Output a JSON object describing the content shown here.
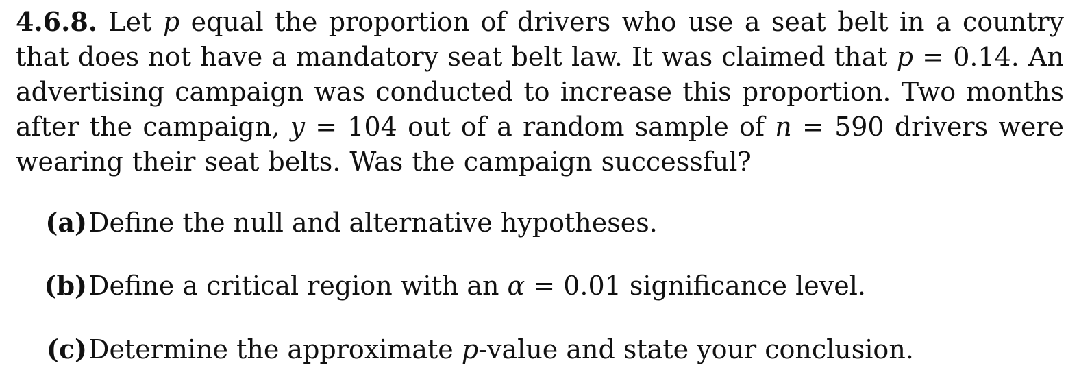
{
  "problem": {
    "number": "4.6.8.",
    "statement": [
      {
        "text": " Let ",
        "math": false
      },
      {
        "text": "p",
        "math": true
      },
      {
        "text": " equal the proportion of drivers who use a seat belt in a country that does not have a mandatory seat belt law.  It was claimed that ",
        "math": false
      },
      {
        "text": "p",
        "math": true
      },
      {
        "text": " = 0.14.  An advertising campaign was conducted to increase this proportion. Two months after the campaign, ",
        "math": false
      },
      {
        "text": "y",
        "math": true
      },
      {
        "text": " = 104 out of a random sample of ",
        "math": false
      },
      {
        "text": "n",
        "math": true
      },
      {
        "text": " = 590 drivers were wearing their seat belts. Was the campaign successful?",
        "math": false
      }
    ]
  },
  "parts": [
    {
      "label": "(a)",
      "segments": [
        {
          "text": "Define the null and alternative hypotheses.",
          "math": false
        }
      ]
    },
    {
      "label": "(b)",
      "segments": [
        {
          "text": "Define a critical region with an ",
          "math": false
        },
        {
          "text": "α",
          "math": true
        },
        {
          "text": " = 0.01 significance level.",
          "math": false
        }
      ]
    },
    {
      "label": "(c)",
      "segments": [
        {
          "text": "Determine the approximate ",
          "math": false
        },
        {
          "text": "p",
          "math": true
        },
        {
          "text": "-value and state your conclusion.",
          "math": false
        }
      ]
    }
  ]
}
